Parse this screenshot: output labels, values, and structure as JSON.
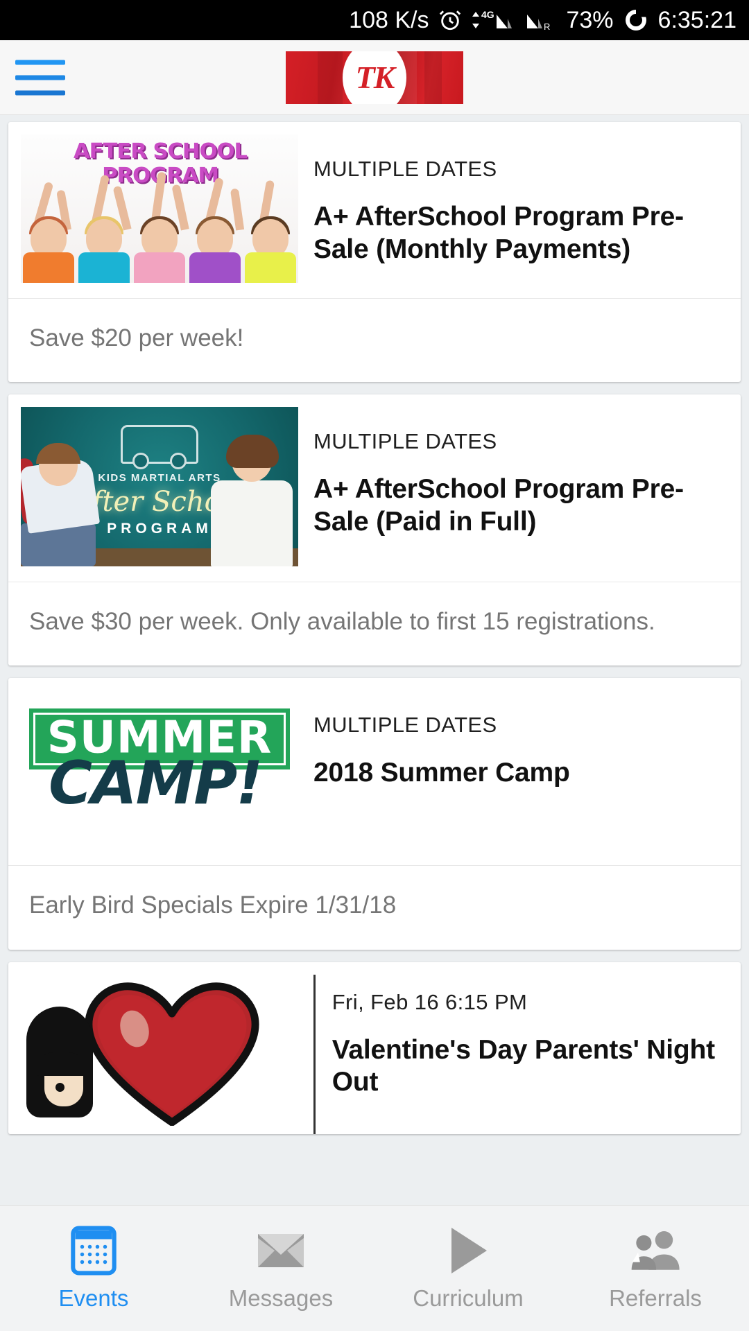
{
  "status_bar": {
    "network_speed": "108 K/s",
    "alarm_icon": "alarm-clock-icon",
    "data_icon": "4G",
    "signal1_icon": "signal-bars-icon",
    "signal2_icon": "signal-bars-roaming-icon",
    "roaming_label": "R",
    "battery": "73%",
    "battery_icon": "battery-circle-icon",
    "time": "6:35:21"
  },
  "header": {
    "menu_icon": "hamburger-menu-icon",
    "logo_text": "TK",
    "logo_color": "#d42027",
    "menu_color": "#2196f3"
  },
  "events": [
    {
      "date": "MULTIPLE DATES",
      "title": "A+ AfterSchool Program Pre-Sale (Monthly Payments)",
      "description": "Save $20 per week!",
      "image_name": "after-school-program-kids-photo",
      "image_caption": "AFTER SCHOOL PROGRAM"
    },
    {
      "date": "MULTIPLE DATES",
      "title": "A+ AfterSchool Program Pre-Sale (Paid in Full)",
      "description": "Save $30 per week. Only available to first 15 registrations.",
      "image_name": "kids-martial-arts-chalkboard-photo",
      "image_caption_small": "KIDS MARTIAL ARTS",
      "image_caption_script": "After School",
      "image_caption_sub": "PROGRAM"
    },
    {
      "date": "MULTIPLE DATES",
      "title": "2018 Summer Camp",
      "description": "Early Bird Specials Expire 1/31/18",
      "image_name": "summer-camp-logo",
      "image_caption_top": "SUMMER",
      "image_caption_bottom": "CAMP!"
    },
    {
      "date": "Fri, Feb 16 6:15 PM",
      "title": "Valentine's Day Parents' Night Out",
      "description": "",
      "image_name": "valentines-heart-ninja-illustration"
    }
  ],
  "bottom_nav": {
    "active_color": "#1f8ef1",
    "inactive_color": "#9a9a9a",
    "items": [
      {
        "label": "Events",
        "icon": "calendar-icon",
        "active": true
      },
      {
        "label": "Messages",
        "icon": "envelope-icon",
        "active": false
      },
      {
        "label": "Curriculum",
        "icon": "play-triangle-icon",
        "active": false
      },
      {
        "label": "Referrals",
        "icon": "people-group-icon",
        "active": false
      }
    ]
  }
}
